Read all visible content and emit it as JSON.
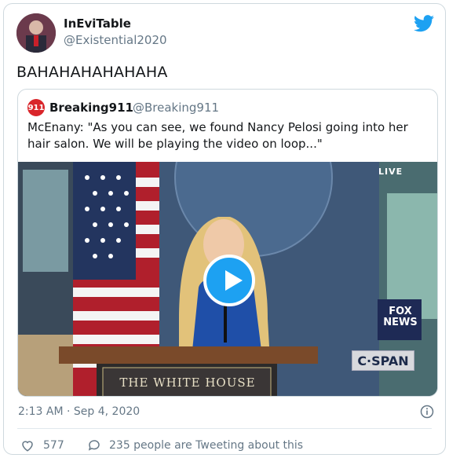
{
  "tweet": {
    "display_name": "InEviTable",
    "handle": "@Existential2020",
    "text": "BAHAHAHAHAHAHA",
    "timestamp": "2:13 AM · Sep 4, 2020",
    "likes": "577",
    "tweeting_text": "235 people are Tweeting about this"
  },
  "quoted_tweet": {
    "avatar_text": "911",
    "display_name": "Breaking911",
    "handle": "@Breaking911",
    "text": "McEnany: \"As you can see, we found Nancy Pelosi going into her hair salon. We will be playing the video on loop...\""
  },
  "video": {
    "live_label": "LIVE",
    "network_label": "C·SPAN",
    "fox_label_1": "FOX",
    "fox_label_2": "NEWS",
    "podium_label": "THE WHITE HOUSE"
  },
  "colors": {
    "accent": "#1da1f2",
    "text": "#14171a",
    "muted": "#657786"
  },
  "icons": [
    "twitter-bird-icon",
    "play-icon",
    "info-icon",
    "heart-icon",
    "comment-bubble-icon"
  ]
}
